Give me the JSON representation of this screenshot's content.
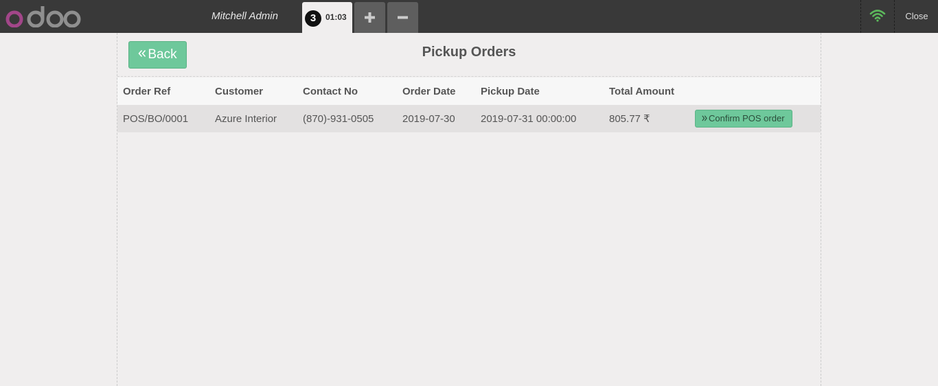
{
  "topbar": {
    "brand": "odoo",
    "user": "Mitchell Admin",
    "order_tab": {
      "sequence": "3",
      "time": "01:03"
    },
    "add_order_icon": "plus-icon",
    "remove_order_icon": "minus-icon",
    "connection_icon": "wifi-icon",
    "connection_color": "#5cb85c",
    "close_label": "Close"
  },
  "screen": {
    "back_label": "Back",
    "title": "Pickup Orders",
    "columns": [
      "Order Ref",
      "Customer",
      "Contact No",
      "Order Date",
      "Pickup Date",
      "Total Amount",
      ""
    ],
    "rows": [
      {
        "order_ref": "POS/BO/0001",
        "customer": "Azure Interior",
        "contact": "(870)-931-0505",
        "order_date": "2019-07-30",
        "pickup_date": "2019-07-31 00:00:00",
        "total": "805.77 ₹",
        "action_label": "Confirm POS order"
      }
    ]
  },
  "colors": {
    "accent": "#6ec89b",
    "topbar": "#393939",
    "background": "#f0eeee"
  }
}
